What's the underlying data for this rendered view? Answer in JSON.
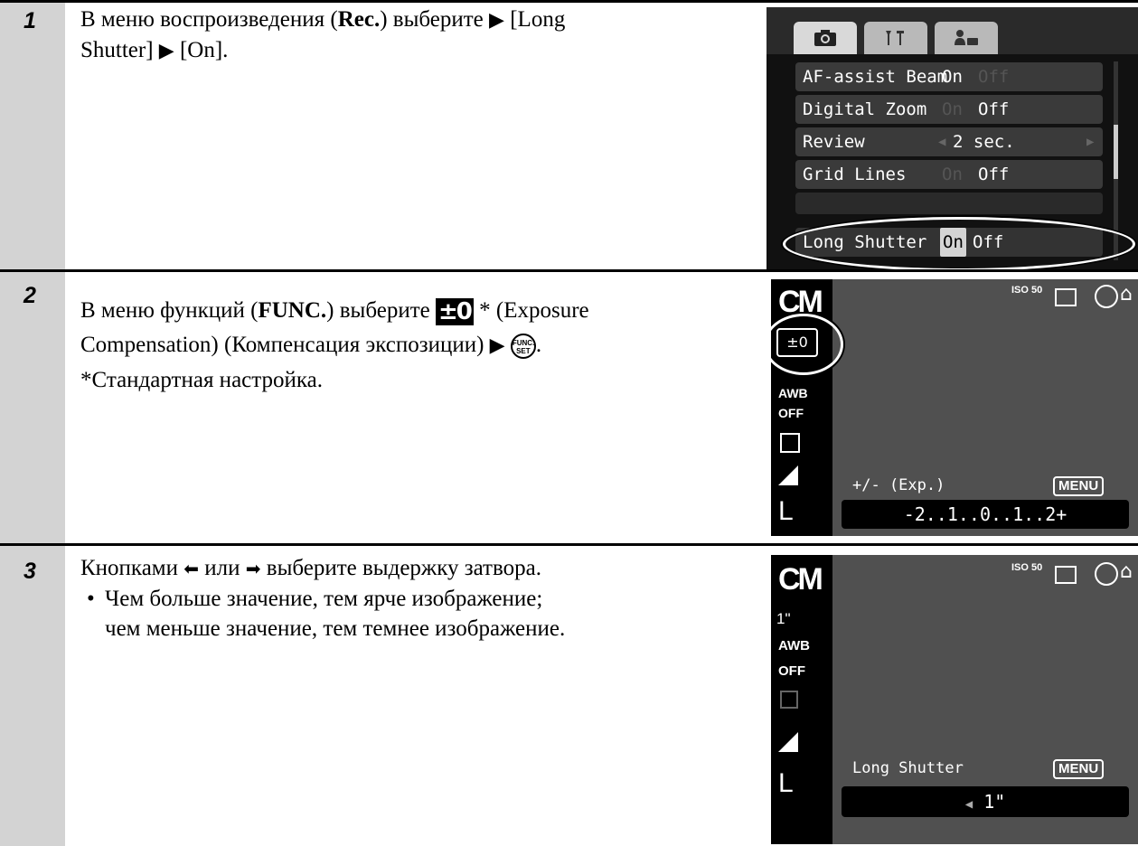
{
  "steps": [
    {
      "number": "1",
      "text_prefix": "В меню воспроизведения (",
      "text_bold": "Rec.",
      "text_mid": ") выберите ",
      "arrow": "▶",
      "text_item": " [Long",
      "text_line2": "Shutter] ",
      "text_end": " [On].",
      "screen": {
        "tabs": [
          "camera-icon",
          "settings-icon",
          "mycamera-icon"
        ],
        "items": [
          {
            "label": "AF-assist Beam",
            "on": "On",
            "off": "Off",
            "active": "On"
          },
          {
            "label": "Digital Zoom",
            "on": "On",
            "off": "Off",
            "active": "Off"
          },
          {
            "label": "Review",
            "value": "2 sec."
          },
          {
            "label": "Grid Lines",
            "on": "On",
            "off": "Off",
            "active": "Off"
          },
          {
            "label": "Long Shutter",
            "on": "On",
            "off": "Off",
            "active": "On"
          }
        ]
      }
    },
    {
      "number": "2",
      "text_prefix": "В меню функций (",
      "text_bold": "FUNC.",
      "text_mid": ") выберите ",
      "icon_pm": "±0",
      "text_item": " * (Exposure",
      "text_line2": "Compensation) (Компенсация экспозиции) ",
      "arrow": "▶",
      "func_icon": "FUNC. SET",
      "text_line3": "*Стандартная настройка.",
      "screen": {
        "mode": "CM",
        "iso": "ISO 50",
        "selected_icon": "±0",
        "side_icons": [
          "AWB",
          "OFF",
          "metering-icon",
          "quality-icon",
          "L"
        ],
        "label": "+/- (Exp.)",
        "menu_badge": "MENU",
        "scale": "-2..1..0..1..2+"
      }
    },
    {
      "number": "3",
      "text_line1_prefix": "Кнопками ",
      "left_arrow": "⬅",
      "text_line1_mid": " или ",
      "right_arrow": "➡",
      "text_line1_end": " выберите выдержку затвора.",
      "bullet": "•",
      "bullet_line1": "Чем больше значение, тем ярче изображение;",
      "bullet_line2": "чем меньше значение, тем темнее изображение.",
      "screen": {
        "mode": "CM",
        "iso": "ISO 50",
        "selected_icon": "1\"",
        "side_icons": [
          "AWB",
          "OFF",
          "metering-icon",
          "quality-icon",
          "L"
        ],
        "label": "Long Shutter",
        "menu_badge": "MENU",
        "value": "1\""
      }
    }
  ]
}
